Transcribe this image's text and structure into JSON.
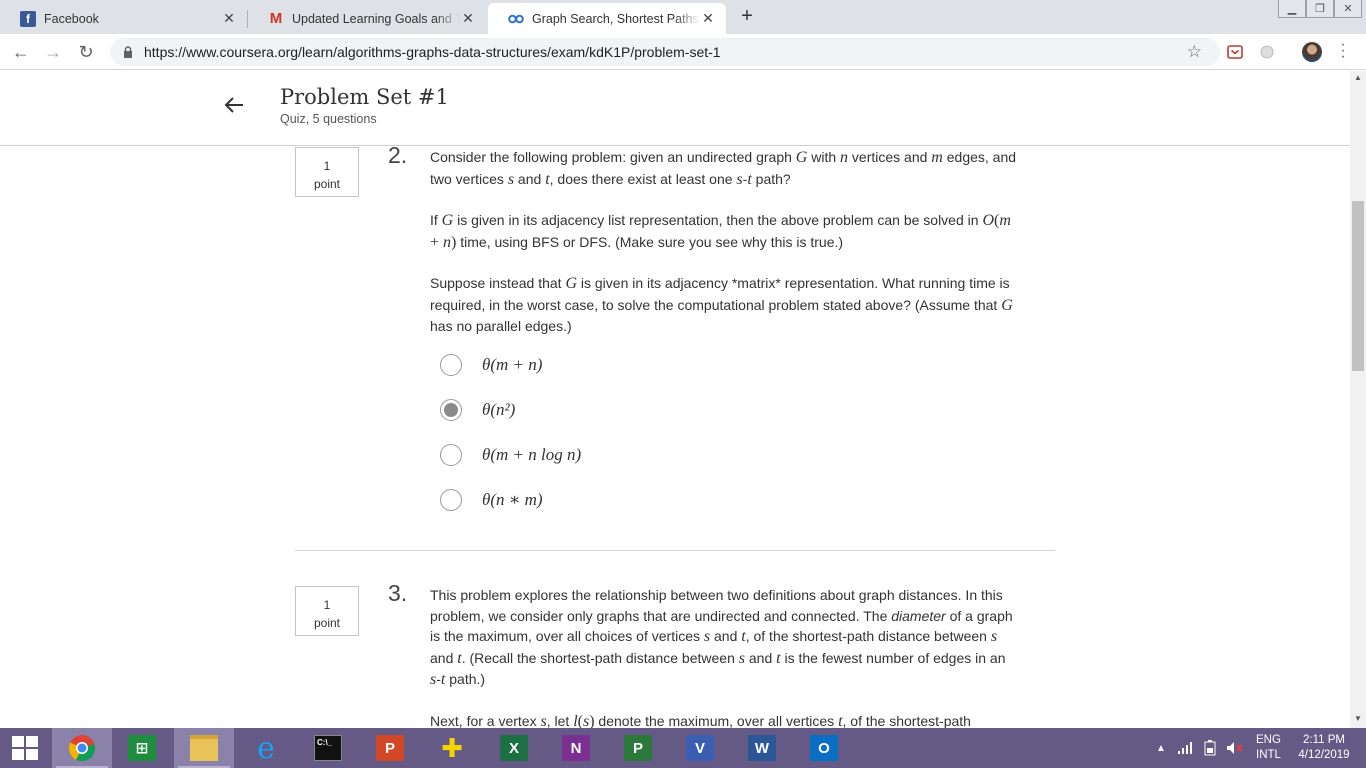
{
  "browser": {
    "tabs": [
      {
        "title": "Facebook",
        "favicon": "facebook-icon",
        "active": false
      },
      {
        "title": "Updated Learning Goals and Tim",
        "favicon": "gmail-icon",
        "active": false
      },
      {
        "title": "Graph Search, Shortest Paths, an",
        "favicon": "coursera-icon",
        "active": true
      }
    ],
    "url": "https://www.coursera.org/learn/algorithms-graphs-data-structures/exam/kdK1P/problem-set-1"
  },
  "header": {
    "title": "Problem Set #1",
    "subtitle": "Quiz, 5 questions"
  },
  "questions": [
    {
      "number": "2.",
      "points_value": "1",
      "points_unit": "point",
      "options": [
        "θ(m + n)",
        "θ(n²)",
        "θ(m + n log n)",
        "θ(n ∗ m)"
      ],
      "selected_index": 1
    },
    {
      "number": "3.",
      "points_value": "1",
      "points_unit": "point"
    }
  ],
  "taskbar": {
    "apps": [
      "windows-start",
      "chrome",
      "store",
      "file-explorer",
      "internet-explorer",
      "command-prompt",
      "powerpoint",
      "game",
      "excel",
      "onenote",
      "project",
      "visio",
      "word",
      "outlook"
    ],
    "lang_top": "ENG",
    "lang_bottom": "INTL",
    "time": "2:11 PM",
    "date": "4/12/2019"
  },
  "colors": {
    "taskbar": "#645a85",
    "tabbar": "#dee1e6",
    "selected_radio": "#8a8a8a"
  }
}
